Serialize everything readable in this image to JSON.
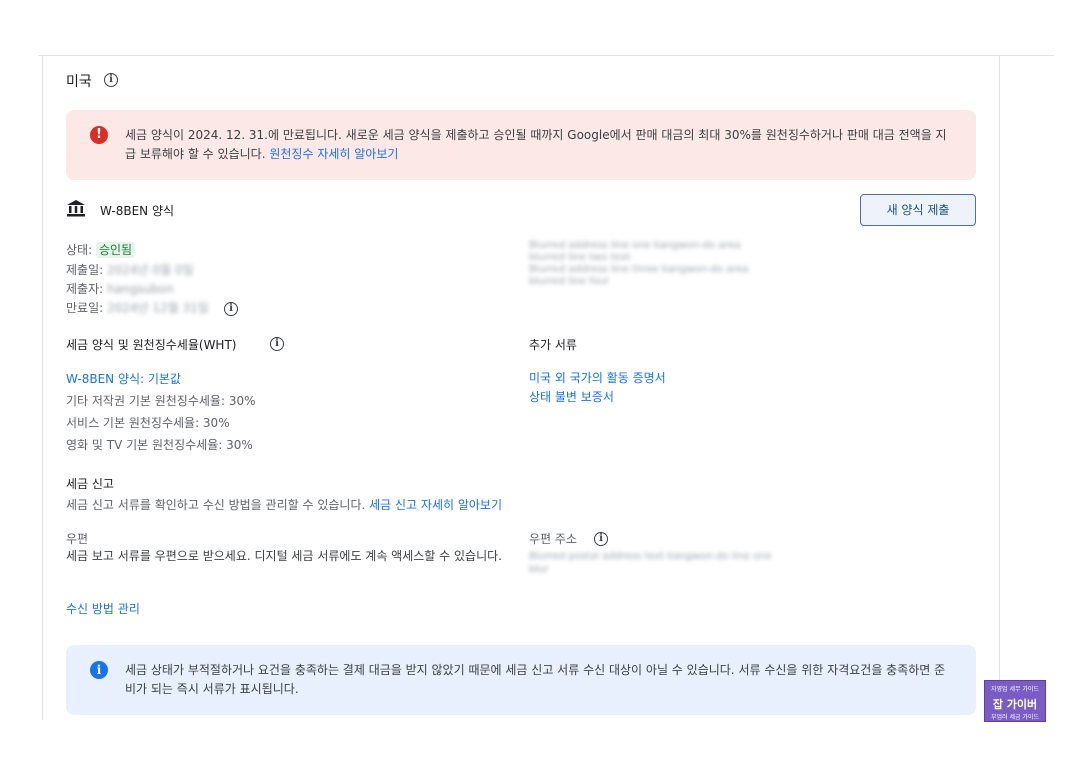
{
  "country": {
    "name": "미국"
  },
  "alert_expiry": {
    "text": "세금 양식이 2024. 12. 31.에 만료됩니다. 새로운 세금 양식을 제출하고 승인될 때까지 Google에서 판매 대금의 최대 30%를 원천징수하거나 판매 대금 전액을 지급 보류해야 할 수 있습니다. ",
    "link": "원천징수 자세히 알아보기"
  },
  "form": {
    "name": "W-8BEN 양식",
    "submit_button": "새 양식 제출",
    "status_label": "상태:",
    "status_value": "승인됨",
    "submitted_label": "제출일:",
    "submitted_value": "2024년 0월 0일",
    "submitter_label": "제출자:",
    "submitter_value": "hangsubon",
    "expiry_label": "만료일:",
    "expiry_value": "2024년 12월 31일",
    "address_blurred": [
      "Blurred address line one kangwon-do area",
      "blurred line two text",
      "Blurred address line three kangwon-do area",
      "blurred line four"
    ]
  },
  "wht": {
    "title": "세금 양식 및 원천징수세율(WHT)",
    "link": "W-8BEN 양식: 기본값",
    "rates": [
      "기타 저작권 기본 원천징수세율: 30%",
      "서비스 기본 원천징수세율: 30%",
      "영화 및 TV 기본 원천징수세율: 30%"
    ]
  },
  "additional_docs": {
    "title": "추가 서류",
    "links": [
      "미국 외 국가의 활동 증명서",
      "상태 불변 보증서"
    ]
  },
  "tax_reporting": {
    "title": "세금 신고",
    "desc": "세금 신고 서류를 확인하고 수신 방법을 관리할 수 있습니다. ",
    "link": "세금 신고 자세히 알아보기"
  },
  "mail": {
    "title": "우편",
    "desc": "세금 보고 서류를 우편으로 받으세요. 디지털 세금 서류에도 계속 액세스할 수 있습니다.",
    "manage_link": "수신 방법 관리",
    "address_label": "우편 주소",
    "address_blurred": [
      "Blurred postal address text kangwon-do line one",
      "blur"
    ]
  },
  "alert_info": {
    "text": "세금 상태가 부적절하거나 요건을 충족하는 결제 대금을 받지 않았기 때문에 세금 신고 서류 수신 대상이 아닐 수 있습니다. 서류 수신을 위한 자격요건을 충족하면 준비가 되는 즉시 서류가 표시됩니다."
  },
  "badge": {
    "top": "자영업 세무 가이드",
    "main": "잡 가이버",
    "bottom": "부업러 세금 가이드"
  },
  "colors": {
    "accent": "#1a73e8",
    "error": "#d93025",
    "success": "#188038"
  }
}
